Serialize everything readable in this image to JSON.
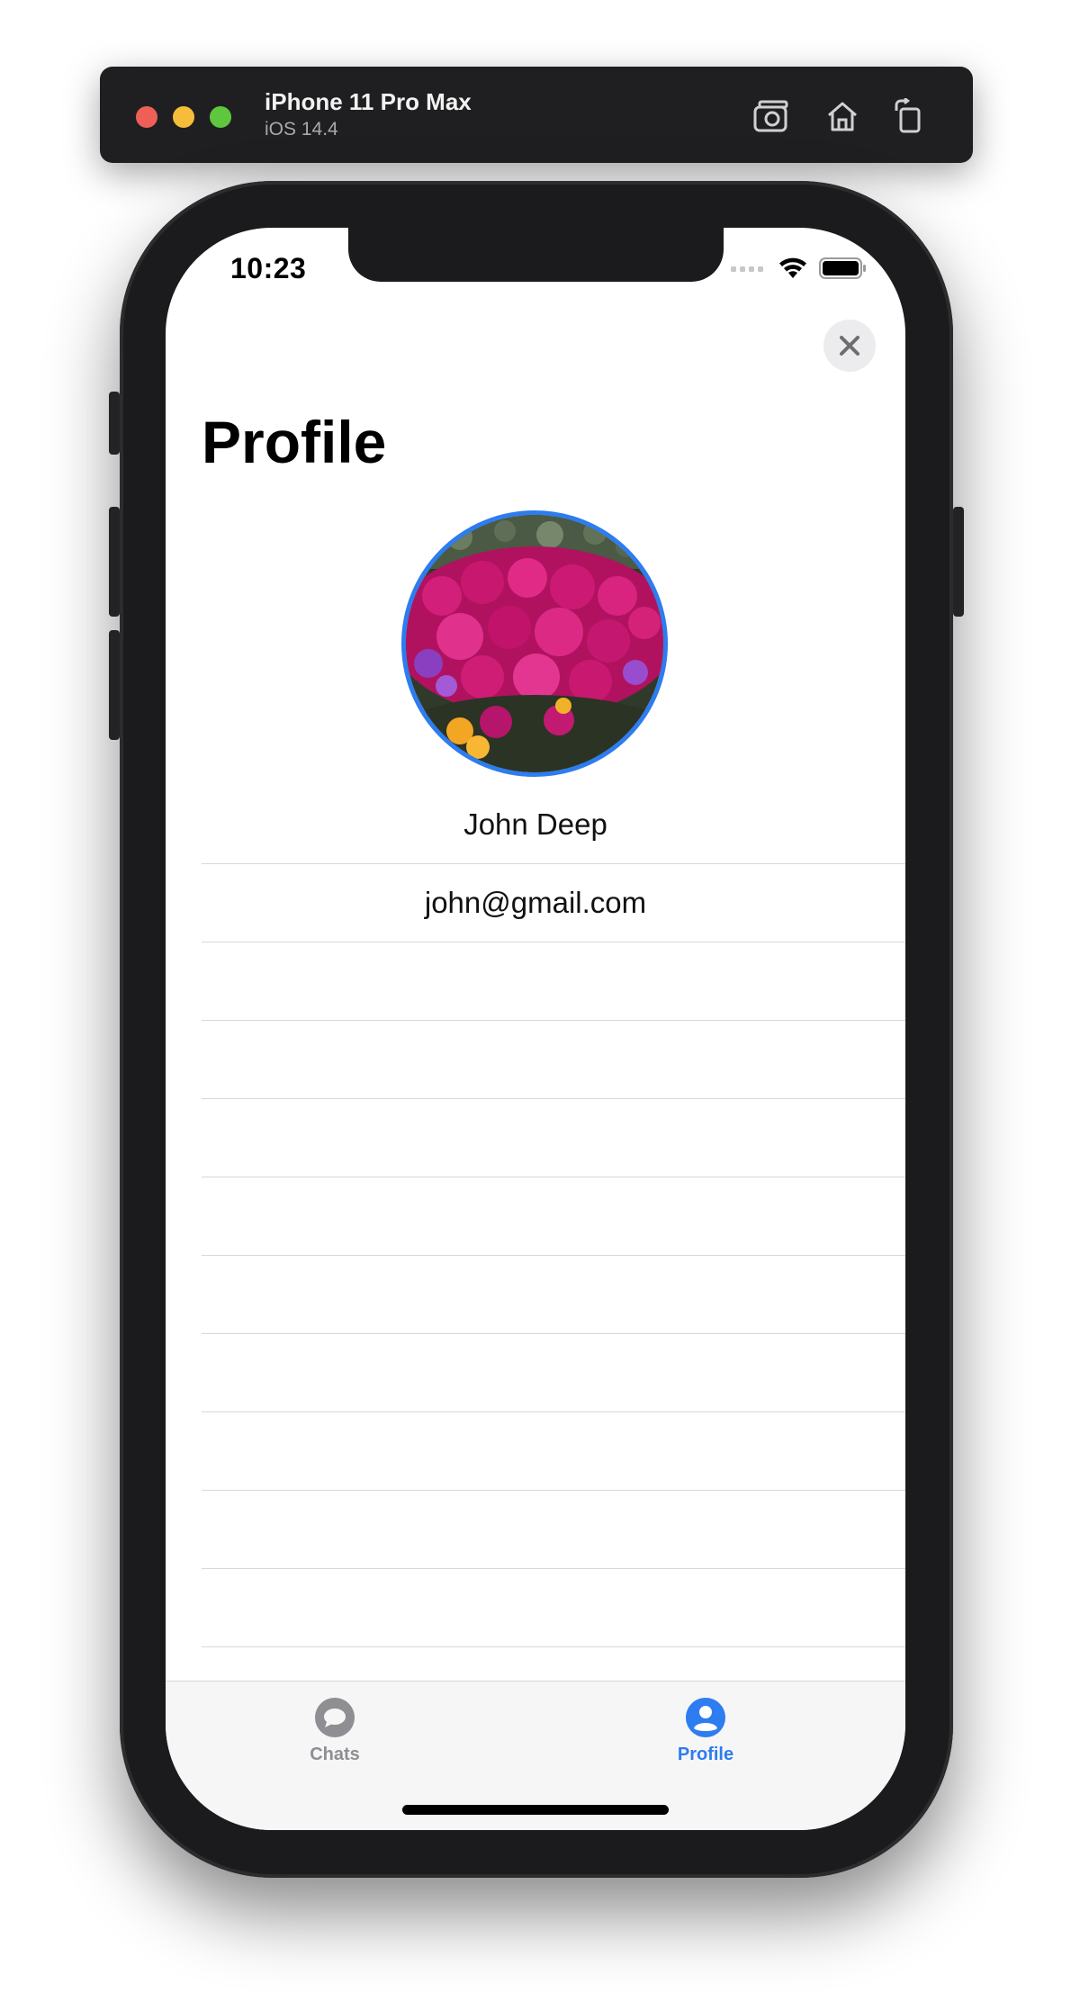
{
  "simulator": {
    "device_name": "iPhone 11 Pro Max",
    "os_version": "iOS 14.4",
    "buttons": [
      {
        "icon": "screenshot-icon"
      },
      {
        "icon": "home-icon"
      },
      {
        "icon": "rotate-icon"
      }
    ]
  },
  "status_bar": {
    "time": "10:23",
    "icons": [
      "cellular-icon",
      "wifi-icon",
      "battery-icon"
    ]
  },
  "header": {
    "close_icon": "close-icon",
    "title": "Profile"
  },
  "profile": {
    "avatar_description": "flower-photo",
    "avatar_ring_color": "#2d7cf0",
    "name": "John Deep",
    "email": "john@gmail.com"
  },
  "tab_bar": {
    "items": [
      {
        "label": "Chats",
        "icon": "chat-bubble-icon",
        "selected": false
      },
      {
        "label": "Profile",
        "icon": "person-circle-icon",
        "selected": true
      }
    ],
    "active_color": "#2d7cf0",
    "inactive_color": "#8e8e93"
  }
}
